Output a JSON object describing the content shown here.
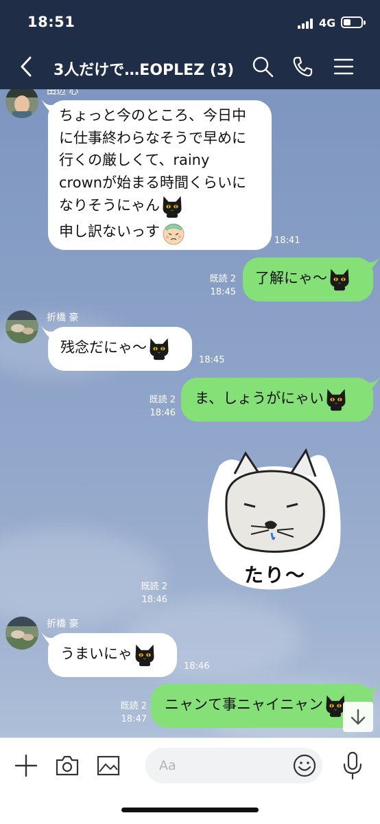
{
  "status_bar": {
    "time": "18:51",
    "network": "4G"
  },
  "header": {
    "title": "3人だけで…EOPLEZ (3)"
  },
  "messages": [
    {
      "sender": "田辺 心",
      "lines": [
        "ちょっと今のところ、今日中",
        "に仕事終わらなそうで早めに",
        "行くの厳しくて、rainy",
        "crownが始まる時間くらいに",
        "なりそうにゃん",
        "申し訳ないっす"
      ],
      "time": "18:41"
    },
    {
      "text": "了解にゃ〜",
      "read": "既読 2",
      "time": "18:45"
    },
    {
      "sender": "折橋 豪",
      "text": "残念だにゃ〜",
      "time": "18:45"
    },
    {
      "text": "ま、しょうがにゃい",
      "read": "既読 2",
      "time": "18:46"
    },
    {
      "sticker_text": "たり〜",
      "read": "既読 2",
      "time": "18:46"
    },
    {
      "sender": "折橋 豪",
      "text": "うまいにゃ",
      "time": "18:46"
    },
    {
      "text": "ニャンて事ニャイニャン",
      "read": "既読 2",
      "time": "18:47"
    }
  ],
  "input": {
    "placeholder": "Aa"
  },
  "icons": [
    "back-icon",
    "search-icon",
    "phone-icon",
    "menu-icon",
    "plus-icon",
    "camera-icon",
    "image-icon",
    "emoji-icon",
    "mic-icon",
    "arrow-down-icon",
    "black-cat-emoji",
    "sick-face-emoji"
  ],
  "colors": {
    "header": "#1f2d46",
    "outgoing_bubble": "#85e078",
    "incoming_bubble": "#ffffff"
  }
}
